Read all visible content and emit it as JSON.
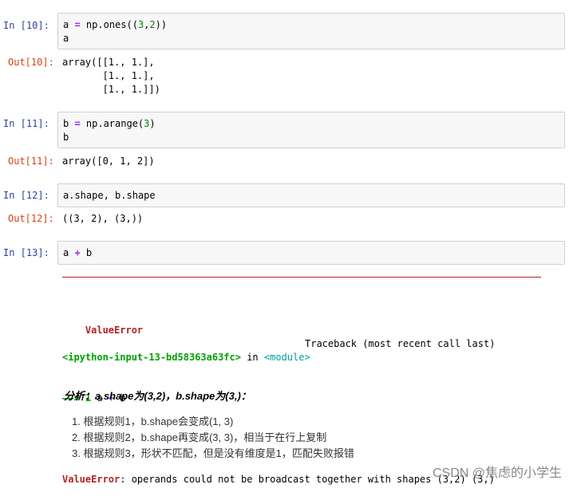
{
  "cells": [
    {
      "in_prompt": "In  [10]:",
      "code": [
        "a = np.ones((3,2))",
        "a"
      ],
      "out_prompt": "Out[10]:",
      "output": [
        "array([[1., 1.],",
        "       [1., 1.],",
        "       [1., 1.]])"
      ]
    },
    {
      "in_prompt": "In  [11]:",
      "code": [
        "b = np.arange(3)",
        "b"
      ],
      "out_prompt": "Out[11]:",
      "output": [
        "array([0, 1, 2])"
      ]
    },
    {
      "in_prompt": "In  [12]:",
      "code": [
        "a.shape, b.shape"
      ],
      "out_prompt": "Out[12]:",
      "output": [
        "((3, 2), (3,))"
      ]
    },
    {
      "in_prompt": "In  [13]:",
      "code": [
        "a + b"
      ]
    }
  ],
  "traceback": {
    "error_name": "ValueError",
    "traceback_header": "Traceback (most recent call last)",
    "input_ref": "<ipython-input-13-bd58363a63fc>",
    "in_word": "in",
    "module": "<module>",
    "arrow": "——> 1",
    "arrow_code": "a + b",
    "message_prefix": "ValueError",
    "message": ": operands could not be broadcast together with shapes (3,2) (3,)"
  },
  "analysis": {
    "title": "分析：a.shape为(3,2)，b.shape为(3,)：",
    "items": [
      "1. 根据规则1，b.shape会变成(1, 3)",
      "2. 根据规则2，b.shape再变成(3, 3)，相当于在行上复制",
      "3. 根据规则3，形状不匹配，但是没有维度是1，匹配失败报错"
    ]
  },
  "watermark": "CSDN @焦虑的小学生",
  "colors": {
    "in_prompt": "#303F9F",
    "out_prompt": "#D84315",
    "error": "#B22222",
    "error_green": "#00A000",
    "number_green": "#008000",
    "operator": "#AA22FF"
  }
}
